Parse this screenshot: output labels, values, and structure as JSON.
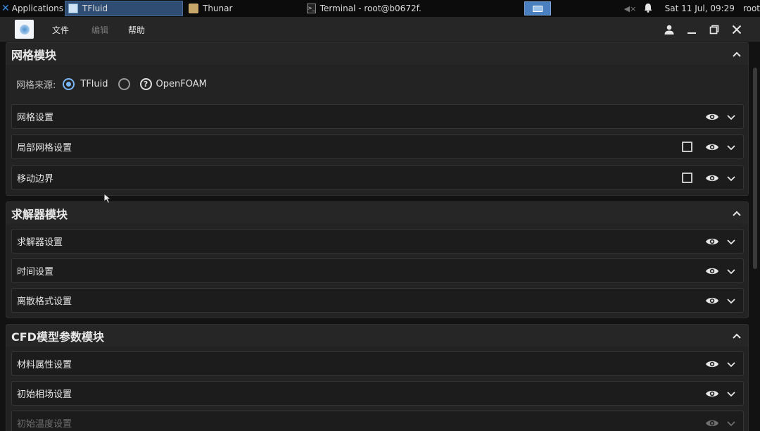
{
  "taskbar": {
    "applications": "Applications",
    "windows": [
      {
        "title": "TFluid",
        "active": true,
        "icon": "app-icon"
      },
      {
        "title": "Thunar",
        "active": false,
        "icon": "folder-icon"
      },
      {
        "title": "Terminal - root@b0672f...",
        "active": false,
        "icon": "terminal-icon"
      }
    ],
    "clock": "Sat 11 Jul, 09:29",
    "user": "root"
  },
  "menu": {
    "file": "文件",
    "edit": "编辑",
    "help": "帮助"
  },
  "mesh_module": {
    "title": "网格模块",
    "source_label": "网格来源:",
    "options": [
      {
        "label": "TFluid",
        "checked": true
      },
      {
        "label": "OpenFOAM",
        "checked": false
      }
    ],
    "rows": [
      {
        "label": "网格设置",
        "has_checkbox": false
      },
      {
        "label": "局部网格设置",
        "has_checkbox": true
      },
      {
        "label": "移动边界",
        "has_checkbox": true
      }
    ]
  },
  "solver_module": {
    "title": "求解器模块",
    "rows": [
      {
        "label": "求解器设置"
      },
      {
        "label": "时间设置"
      },
      {
        "label": "离散格式设置"
      }
    ]
  },
  "cfd_module": {
    "title": "CFD模型参数模块",
    "rows": [
      {
        "label": "材料属性设置"
      },
      {
        "label": "初始相场设置"
      },
      {
        "label": "初始温度设置"
      }
    ]
  },
  "colors": {
    "accent": "#7ab6f5",
    "panel": "#232323",
    "row": "#1c1c1c",
    "active_window": "#2f4d73"
  }
}
